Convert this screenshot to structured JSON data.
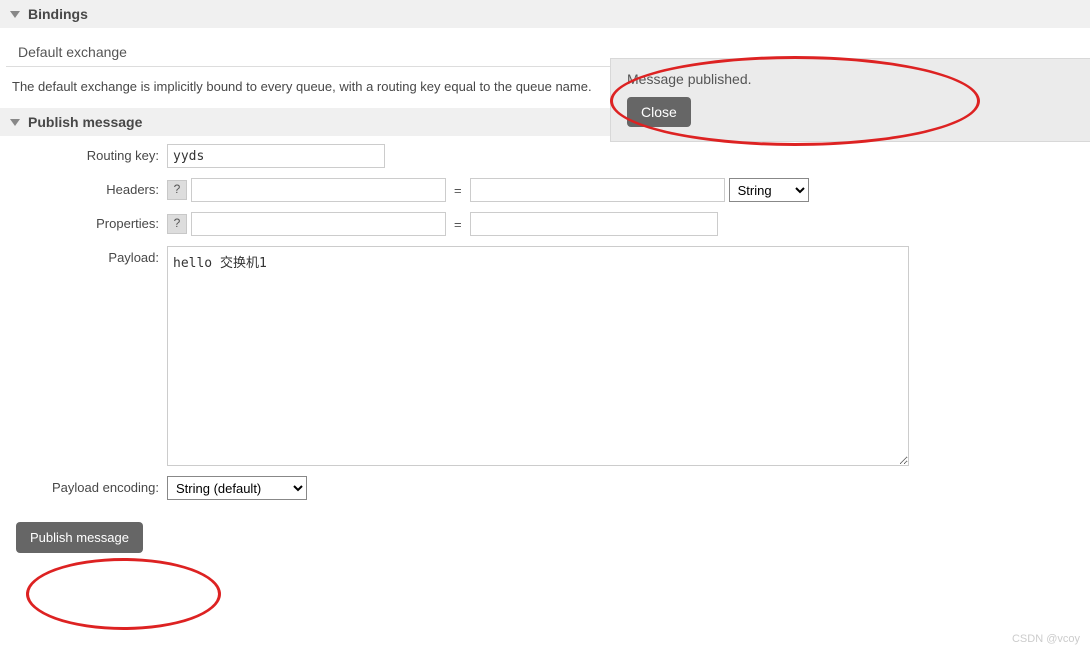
{
  "sections": {
    "bindings": {
      "title": "Bindings",
      "subheader": "Default exchange",
      "description": "The default exchange is implicitly bound to every queue, with a routing key equal to the queue name."
    },
    "publish": {
      "title": "Publish message"
    }
  },
  "form": {
    "routing_key": {
      "label": "Routing key:",
      "value": "yyds"
    },
    "headers": {
      "label": "Headers:",
      "help": "?",
      "key": "",
      "value": "",
      "type_options": [
        "String"
      ],
      "type_selected": "String"
    },
    "properties": {
      "label": "Properties:",
      "help": "?",
      "key": "",
      "value": ""
    },
    "payload": {
      "label": "Payload:",
      "value": "hello 交换机1"
    },
    "payload_encoding": {
      "label": "Payload encoding:",
      "options": [
        "String (default)"
      ],
      "selected": "String (default)"
    },
    "submit_label": "Publish message"
  },
  "toast": {
    "message": "Message published.",
    "close_label": "Close"
  },
  "watermark": "CSDN @vcoy"
}
